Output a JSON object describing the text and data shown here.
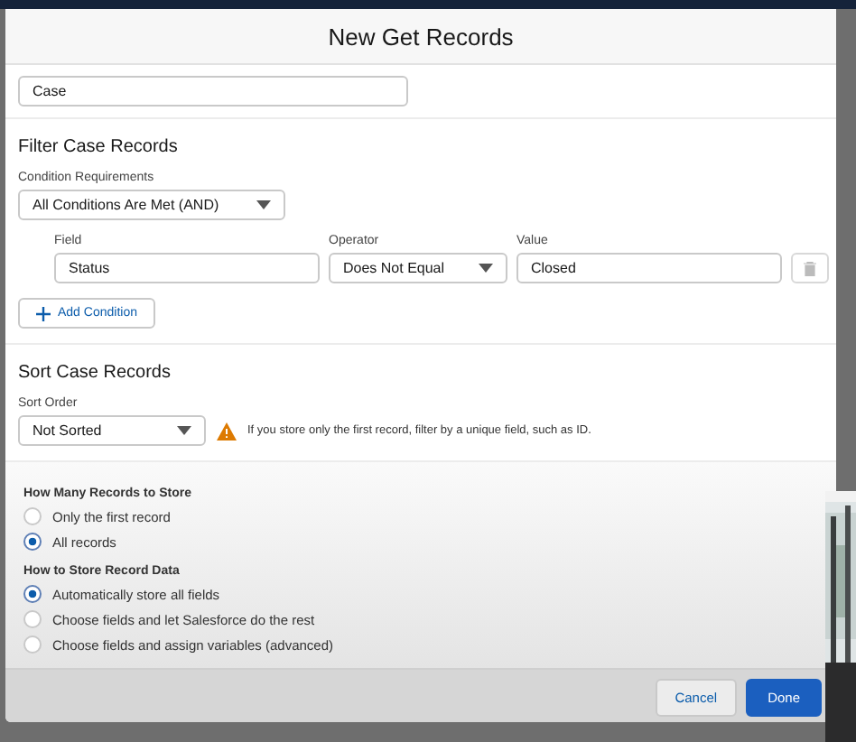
{
  "modal": {
    "title": "New Get Records"
  },
  "object_field": {
    "value": "Case"
  },
  "filter": {
    "heading": "Filter Case Records",
    "requirements_label": "Condition Requirements",
    "requirements_value": "All Conditions Are Met (AND)",
    "columns": [
      "Field",
      "Operator",
      "Value"
    ],
    "conditions": [
      {
        "field": "Status",
        "operator": "Does Not Equal",
        "value": "Closed"
      }
    ],
    "add_button": "Add Condition"
  },
  "sort": {
    "heading": "Sort Case Records",
    "order_label": "Sort Order",
    "order_value": "Not Sorted",
    "warning": "If you store only the first record, filter by a unique field, such as ID."
  },
  "store_count": {
    "heading": "How Many Records to Store",
    "options": [
      {
        "label": "Only the first record",
        "selected": false
      },
      {
        "label": "All records",
        "selected": true
      }
    ]
  },
  "store_data": {
    "heading": "How to Store Record Data",
    "options": [
      {
        "label": "Automatically store all fields",
        "selected": true
      },
      {
        "label": "Choose fields and let Salesforce do the rest",
        "selected": false
      },
      {
        "label": "Choose fields and assign variables (advanced)",
        "selected": false
      }
    ]
  },
  "footer": {
    "buttons": [
      {
        "label": "Cancel",
        "kind": "neutral"
      },
      {
        "label": "Done",
        "kind": "brand"
      }
    ]
  }
}
